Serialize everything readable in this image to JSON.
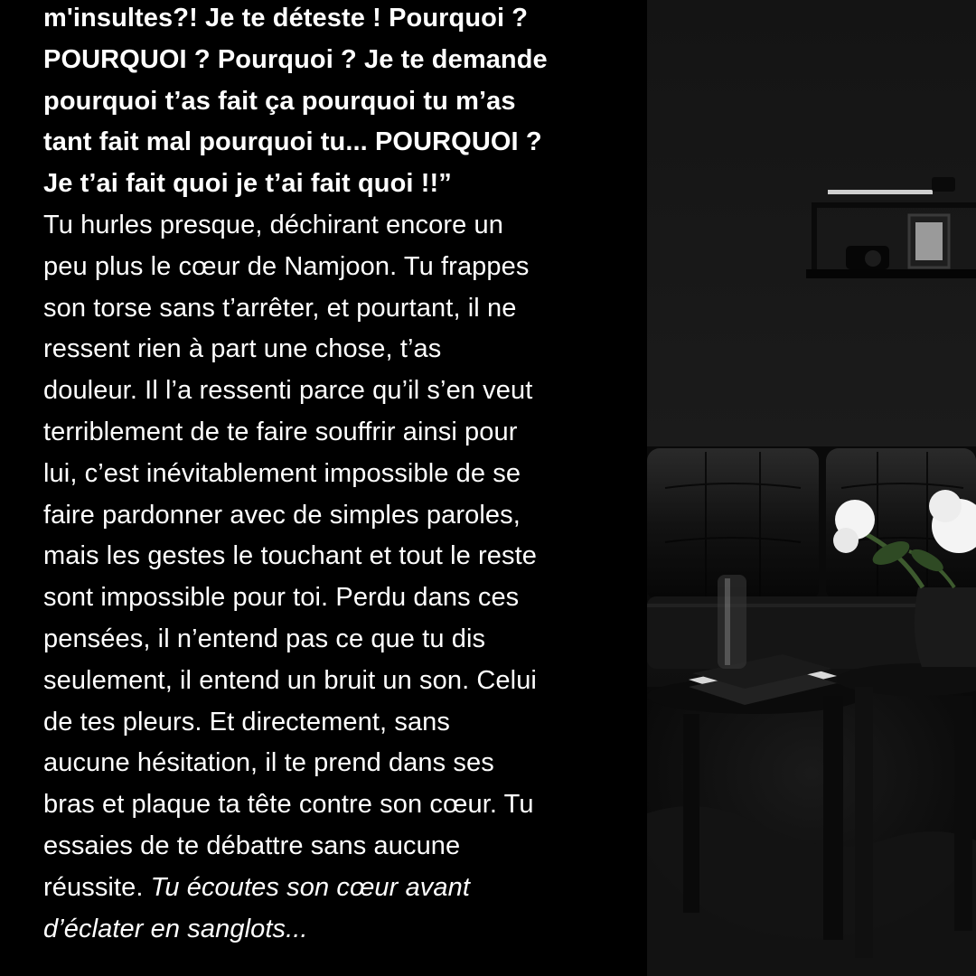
{
  "story": {
    "lines": [
      {
        "text": "m'insultes?! Je te déteste ! Pourquoi ?",
        "style": "bold"
      },
      {
        "text": "POURQUOI ? Pourquoi ? Je te demande",
        "style": "bold"
      },
      {
        "text": "pourquoi t’as fait ça pourquoi tu m’as",
        "style": "bold"
      },
      {
        "text": "tant fait mal pourquoi tu... POURQUOI ?",
        "style": "bold"
      },
      {
        "text": "Je t’ai fait quoi je t’ai fait quoi !!”",
        "style": "bold"
      },
      {
        "text": "Tu hurles presque, déchirant encore un",
        "style": "regular"
      },
      {
        "text": "peu plus le cœur de Namjoon. Tu frappes",
        "style": "regular"
      },
      {
        "text": "son torse sans t’arrêter, et pourtant, il ne",
        "style": "regular"
      },
      {
        "text": "ressent rien à part une chose, t’as",
        "style": "regular"
      },
      {
        "text": "douleur. Il l’a ressenti parce qu’il s’en veut",
        "style": "regular"
      },
      {
        "text": "terriblement de te faire souffrir ainsi pour",
        "style": "regular"
      },
      {
        "text": "lui, c’est inévitablement impossible de se",
        "style": "regular"
      },
      {
        "text": "faire pardonner avec de simples paroles,",
        "style": "regular"
      },
      {
        "text": "mais les gestes le touchant et tout le reste",
        "style": "regular"
      },
      {
        "text": "sont impossible pour toi. Perdu dans ces",
        "style": "regular"
      },
      {
        "text": "pensées, il n’entend pas ce que tu dis",
        "style": "regular"
      },
      {
        "text": "seulement, il entend un bruit un son. Celui",
        "style": "regular"
      },
      {
        "text": "de tes pleurs. Et directement, sans",
        "style": "regular"
      },
      {
        "text": "aucune hésitation, il te prend dans ses",
        "style": "regular"
      },
      {
        "text": "bras et plaque ta tête contre son cœur. Tu",
        "style": "regular"
      },
      {
        "text": "essaies de te débattre sans aucune",
        "style": "regular"
      }
    ],
    "line22_regular": "réussite. ",
    "line22_italic": "Tu écoutes son cœur avant",
    "line23_italic": "d’éclater en sanglots..."
  },
  "colors": {
    "text": "#ffffff",
    "background": "#000000",
    "room_wall": "#161616",
    "leather": "#0d0d0d",
    "flowers": "#f4f4f4",
    "leaves": "#3d5a2e"
  }
}
